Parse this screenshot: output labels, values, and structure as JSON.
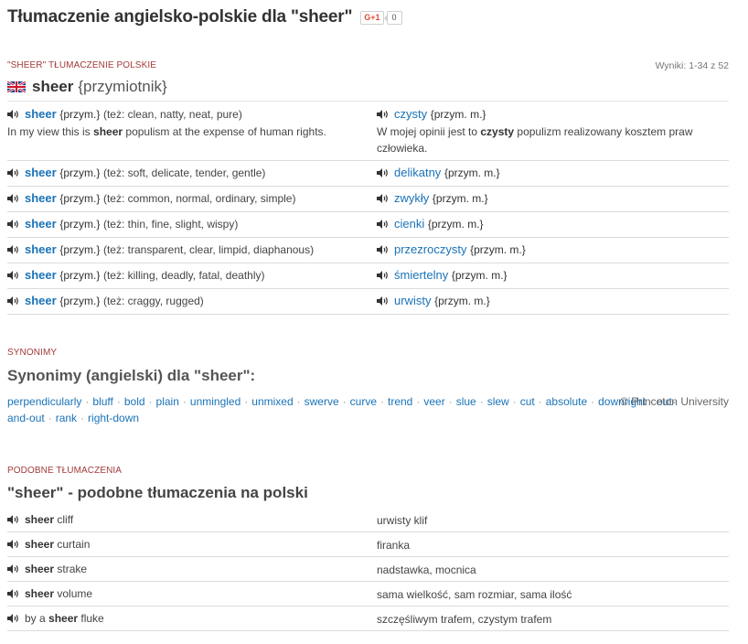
{
  "header": {
    "title": "Tłumaczenie angielsko-polskie dla \"sheer\"",
    "gplus_label": "G+1",
    "gplus_count": "0"
  },
  "translations": {
    "section_label": "\"SHEER\" TŁUMACZENIE POLSKIE",
    "results": "Wyniki: 1-34 z 52",
    "headword": "sheer",
    "pos": "{przymiotnik}",
    "rows": [
      {
        "en": "sheer",
        "en_gram": "{przym.}",
        "also": "(też: clean, natty, neat, pure)",
        "pl": "czysty",
        "pl_gram": "{przym. m.}",
        "ex_en_pre": "In my view this is ",
        "ex_en_bold": "sheer",
        "ex_en_post": " populism at the expense of human rights.",
        "ex_pl_pre": "W mojej opinii jest to ",
        "ex_pl_bold": "czysty",
        "ex_pl_post": " populizm realizowany kosztem praw człowieka."
      },
      {
        "en": "sheer",
        "en_gram": "{przym.}",
        "also": "(też: soft, delicate, tender, gentle)",
        "pl": "delikatny",
        "pl_gram": "{przym. m.}"
      },
      {
        "en": "sheer",
        "en_gram": "{przym.}",
        "also": "(też: common, normal, ordinary, simple)",
        "pl": "zwykły",
        "pl_gram": "{przym. m.}"
      },
      {
        "en": "sheer",
        "en_gram": "{przym.}",
        "also": "(też: thin, fine, slight, wispy)",
        "pl": "cienki",
        "pl_gram": "{przym. m.}"
      },
      {
        "en": "sheer",
        "en_gram": "{przym.}",
        "also": "(też: transparent, clear, limpid, diaphanous)",
        "pl": "przezroczysty",
        "pl_gram": "{przym. m.}"
      },
      {
        "en": "sheer",
        "en_gram": "{przym.}",
        "also": "(też: killing, deadly, fatal, deathly)",
        "pl": "śmiertelny",
        "pl_gram": "{przym. m.}"
      },
      {
        "en": "sheer",
        "en_gram": "{przym.}",
        "also": "(też: craggy, rugged)",
        "pl": "urwisty",
        "pl_gram": "{przym. m.}"
      }
    ]
  },
  "synonyms": {
    "section_label": "SYNONIMY",
    "heading": "Synonimy (angielski) dla \"sheer\":",
    "source": "© Princeton University",
    "items": [
      "perpendicularly",
      "bluff",
      "bold",
      "plain",
      "unmingled",
      "unmixed",
      "swerve",
      "curve",
      "trend",
      "veer",
      "slue",
      "slew",
      "cut",
      "absolute",
      "downright",
      "out-and-out",
      "rank",
      "right-down"
    ]
  },
  "similar": {
    "section_label": "PODOBNE TŁUMACZENIA",
    "heading": "\"sheer\" - podobne tłumaczenia na polski",
    "rows": [
      {
        "pre": "",
        "bold": "sheer",
        "post": " cliff",
        "pl": "urwisty klif"
      },
      {
        "pre": "",
        "bold": "sheer",
        "post": " curtain",
        "pl": "firanka"
      },
      {
        "pre": "",
        "bold": "sheer",
        "post": " strake",
        "pl": "nadstawka, mocnica"
      },
      {
        "pre": "",
        "bold": "sheer",
        "post": " volume",
        "pl": "sama wielkość, sam rozmiar, sama ilość"
      },
      {
        "pre": "by a ",
        "bold": "sheer",
        "post": " fluke",
        "pl": "szczęśliwym trafem, czystym trafem"
      }
    ]
  },
  "icons": {
    "speaker": "speaker-icon",
    "flag": "uk-flag-icon"
  },
  "colors": {
    "link": "#1a73b8",
    "section_label": "#a33a3a"
  }
}
